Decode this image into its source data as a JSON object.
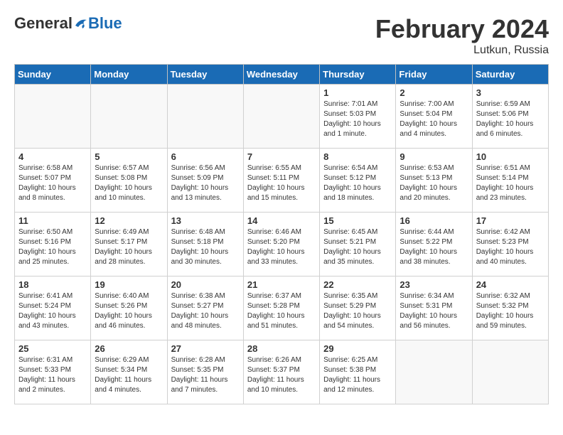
{
  "logo": {
    "general": "General",
    "blue": "Blue"
  },
  "title": "February 2024",
  "subtitle": "Lutkun, Russia",
  "header_days": [
    "Sunday",
    "Monday",
    "Tuesday",
    "Wednesday",
    "Thursday",
    "Friday",
    "Saturday"
  ],
  "weeks": [
    [
      {
        "num": "",
        "info": ""
      },
      {
        "num": "",
        "info": ""
      },
      {
        "num": "",
        "info": ""
      },
      {
        "num": "",
        "info": ""
      },
      {
        "num": "1",
        "info": "Sunrise: 7:01 AM\nSunset: 5:03 PM\nDaylight: 10 hours and 1 minute."
      },
      {
        "num": "2",
        "info": "Sunrise: 7:00 AM\nSunset: 5:04 PM\nDaylight: 10 hours and 4 minutes."
      },
      {
        "num": "3",
        "info": "Sunrise: 6:59 AM\nSunset: 5:06 PM\nDaylight: 10 hours and 6 minutes."
      }
    ],
    [
      {
        "num": "4",
        "info": "Sunrise: 6:58 AM\nSunset: 5:07 PM\nDaylight: 10 hours and 8 minutes."
      },
      {
        "num": "5",
        "info": "Sunrise: 6:57 AM\nSunset: 5:08 PM\nDaylight: 10 hours and 10 minutes."
      },
      {
        "num": "6",
        "info": "Sunrise: 6:56 AM\nSunset: 5:09 PM\nDaylight: 10 hours and 13 minutes."
      },
      {
        "num": "7",
        "info": "Sunrise: 6:55 AM\nSunset: 5:11 PM\nDaylight: 10 hours and 15 minutes."
      },
      {
        "num": "8",
        "info": "Sunrise: 6:54 AM\nSunset: 5:12 PM\nDaylight: 10 hours and 18 minutes."
      },
      {
        "num": "9",
        "info": "Sunrise: 6:53 AM\nSunset: 5:13 PM\nDaylight: 10 hours and 20 minutes."
      },
      {
        "num": "10",
        "info": "Sunrise: 6:51 AM\nSunset: 5:14 PM\nDaylight: 10 hours and 23 minutes."
      }
    ],
    [
      {
        "num": "11",
        "info": "Sunrise: 6:50 AM\nSunset: 5:16 PM\nDaylight: 10 hours and 25 minutes."
      },
      {
        "num": "12",
        "info": "Sunrise: 6:49 AM\nSunset: 5:17 PM\nDaylight: 10 hours and 28 minutes."
      },
      {
        "num": "13",
        "info": "Sunrise: 6:48 AM\nSunset: 5:18 PM\nDaylight: 10 hours and 30 minutes."
      },
      {
        "num": "14",
        "info": "Sunrise: 6:46 AM\nSunset: 5:20 PM\nDaylight: 10 hours and 33 minutes."
      },
      {
        "num": "15",
        "info": "Sunrise: 6:45 AM\nSunset: 5:21 PM\nDaylight: 10 hours and 35 minutes."
      },
      {
        "num": "16",
        "info": "Sunrise: 6:44 AM\nSunset: 5:22 PM\nDaylight: 10 hours and 38 minutes."
      },
      {
        "num": "17",
        "info": "Sunrise: 6:42 AM\nSunset: 5:23 PM\nDaylight: 10 hours and 40 minutes."
      }
    ],
    [
      {
        "num": "18",
        "info": "Sunrise: 6:41 AM\nSunset: 5:24 PM\nDaylight: 10 hours and 43 minutes."
      },
      {
        "num": "19",
        "info": "Sunrise: 6:40 AM\nSunset: 5:26 PM\nDaylight: 10 hours and 46 minutes."
      },
      {
        "num": "20",
        "info": "Sunrise: 6:38 AM\nSunset: 5:27 PM\nDaylight: 10 hours and 48 minutes."
      },
      {
        "num": "21",
        "info": "Sunrise: 6:37 AM\nSunset: 5:28 PM\nDaylight: 10 hours and 51 minutes."
      },
      {
        "num": "22",
        "info": "Sunrise: 6:35 AM\nSunset: 5:29 PM\nDaylight: 10 hours and 54 minutes."
      },
      {
        "num": "23",
        "info": "Sunrise: 6:34 AM\nSunset: 5:31 PM\nDaylight: 10 hours and 56 minutes."
      },
      {
        "num": "24",
        "info": "Sunrise: 6:32 AM\nSunset: 5:32 PM\nDaylight: 10 hours and 59 minutes."
      }
    ],
    [
      {
        "num": "25",
        "info": "Sunrise: 6:31 AM\nSunset: 5:33 PM\nDaylight: 11 hours and 2 minutes."
      },
      {
        "num": "26",
        "info": "Sunrise: 6:29 AM\nSunset: 5:34 PM\nDaylight: 11 hours and 4 minutes."
      },
      {
        "num": "27",
        "info": "Sunrise: 6:28 AM\nSunset: 5:35 PM\nDaylight: 11 hours and 7 minutes."
      },
      {
        "num": "28",
        "info": "Sunrise: 6:26 AM\nSunset: 5:37 PM\nDaylight: 11 hours and 10 minutes."
      },
      {
        "num": "29",
        "info": "Sunrise: 6:25 AM\nSunset: 5:38 PM\nDaylight: 11 hours and 12 minutes."
      },
      {
        "num": "",
        "info": ""
      },
      {
        "num": "",
        "info": ""
      }
    ]
  ]
}
